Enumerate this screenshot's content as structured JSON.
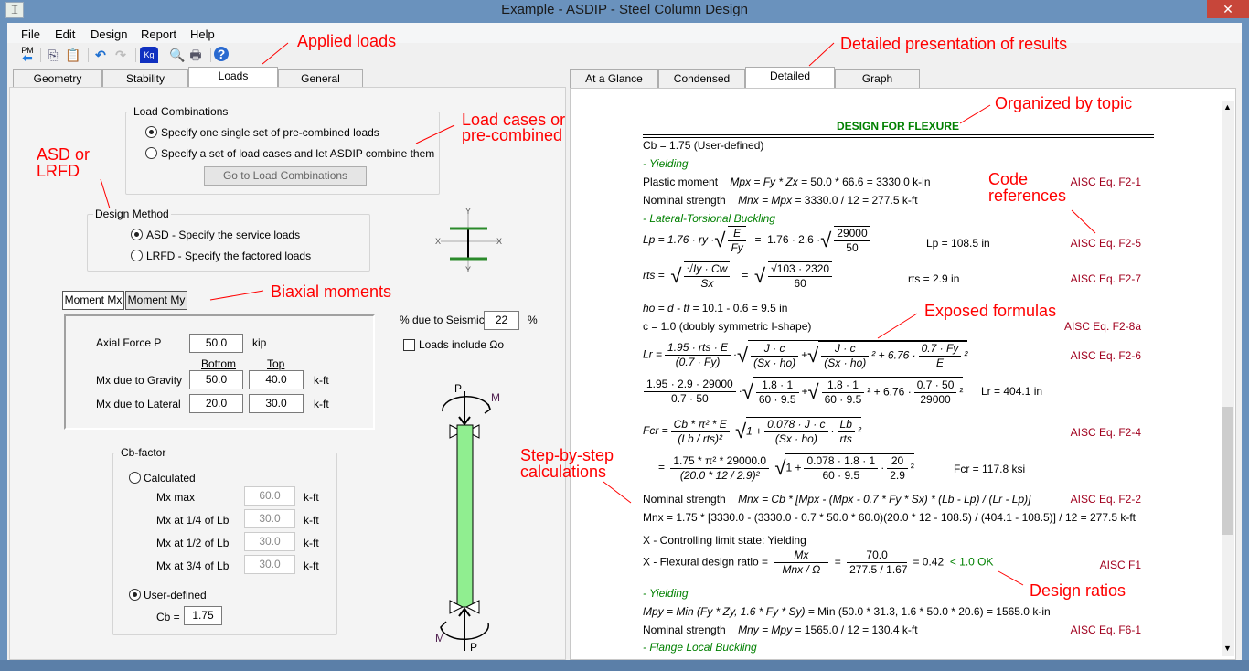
{
  "window": {
    "title": "Example - ASDIP - Steel Column Design",
    "close": "✕",
    "app_icon": "I-beam-icon"
  },
  "menu": [
    "File",
    "Edit",
    "Design",
    "Report",
    "Help"
  ],
  "toolbar": {
    "pm": "PM",
    "icons": [
      "pm-back-icon",
      "copy-icon",
      "paste-icon",
      "undo-icon",
      "redo-icon",
      "units-kg-icon",
      "preview-icon",
      "print-icon",
      "help-icon"
    ]
  },
  "left_tabs": [
    "Geometry",
    "Stability",
    "Loads",
    "General"
  ],
  "right_tabs": [
    "At a Glance",
    "Condensed",
    "Detailed",
    "Graph"
  ],
  "loads": {
    "load_combinations": {
      "title": "Load Combinations",
      "opt1": "Specify one single set of pre-combined loads",
      "opt2": "Specify a set of load cases and let ASDIP combine them",
      "button": "Go to Load Combinations"
    },
    "design_method": {
      "title": "Design Method",
      "asd": "ASD - Specify the service loads",
      "lrfd": "LRFD - Specify the factored loads"
    },
    "section": {
      "x": "X",
      "y": "Y"
    },
    "moment_tabs": [
      "Moment Mx",
      "Moment My"
    ],
    "axial_label": "Axial Force  P",
    "axial_value": "50.0",
    "axial_unit": "kip",
    "col_bottom": "Bottom",
    "col_top": "Top",
    "gravity_label": "Mx due to Gravity",
    "gravity_bottom": "50.0",
    "gravity_top": "40.0",
    "lateral_label": "Mx due to Lateral",
    "lateral_bottom": "20.0",
    "lateral_top": "30.0",
    "moment_unit": "k-ft",
    "seismic_label": "% due to Seismic",
    "seismic_value": "22",
    "seismic_unit": "%",
    "omega_label": "Loads include Ωo",
    "cb": {
      "title": "Cb-factor",
      "calculated": "Calculated",
      "mxmax_label": "Mx max",
      "mxmax": "60.0",
      "q1_label": "Mx at 1/4 of Lb",
      "q1": "30.0",
      "q2_label": "Mx at 1/2 of Lb",
      "q2": "30.0",
      "q3_label": "Mx at 3/4 of Lb",
      "q3": "30.0",
      "unit": "k-ft",
      "user": "User-defined",
      "cb_label": "Cb =",
      "cb_value": "1.75"
    },
    "diagram": {
      "p": "P",
      "m": "M"
    }
  },
  "report": {
    "heading": "DESIGN FOR FLEXURE",
    "cb": "Cb = 1.75    (User-defined)",
    "yielding": "- Yielding",
    "plastic_label": "Plastic moment",
    "plastic_f": "Mpx = Fy * Zx = ",
    "plastic_v": " 50.0 * 66.6 = 3330.0 k-in",
    "ref_f21": "AISC Eq. F2-1",
    "nominal_label": "Nominal strength",
    "nominal_f": "Mnx = Mpx = ",
    "nominal_v": " 3330.0 / 12  = 277.5 k-ft",
    "ltb": "- Lateral-Torsional Buckling",
    "lp": {
      "lhs": "Lp =  1.76 · ry ·",
      "num": "E",
      "den": "Fy",
      "eq": "=",
      "mid": "1.76 · 2.6 ·",
      "num2": "29000",
      "den2": "50",
      "result": "Lp = 108.5 in",
      "ref": "AISC Eq. F2-5"
    },
    "rts": {
      "lhs": "rts =",
      "num": "√Iy · Cw",
      "den": "Sx",
      "eq": "=",
      "num2": "√103 · 2320",
      "den2": "60",
      "result": "rts = 2.9 in",
      "ref": "AISC Eq. F2-7"
    },
    "ho": "ho = d - tf = ",
    "ho_v": " 10.1 - 0.6 = 9.5 in",
    "c": "c = 1.0     (doubly symmetric I-shape)",
    "ref_f28a": "AISC Eq. F2-8a",
    "lr": {
      "lhs": "Lr =",
      "n1": "1.95 · rts · E",
      "d1": "(0.7 · Fy)",
      "n2": "J · c",
      "d2": "(Sx · ho)",
      "n3": "J · c",
      "d3": "(Sx · ho)",
      "plus": "+ 6.76 ·",
      "n4": "0.7 · Fy",
      "d4": "E",
      "ref": "AISC Eq. F2-6"
    },
    "lr_num": {
      "n1": "1.95 · 2.9 · 29000",
      "d1": "0.7 · 50",
      "n2": "1.8 · 1",
      "d2": "60 · 9.5",
      "n3": "1.8 · 1",
      "d3": "60 · 9.5",
      "plus": "+ 6.76 ·",
      "n4": "0.7 · 50",
      "d4": "29000",
      "result": "Lr = 404.1 in"
    },
    "fcr": {
      "lhs": "Fcr =",
      "n1": "Cb * π² * E",
      "d1": "(Lb / rts)²",
      "one": "1 +",
      "n2": "0.078 · J · c",
      "d2": "(Sx · ho)",
      "n3": "Lb",
      "d3": "rts",
      "ref": "AISC Eq. F2-4"
    },
    "fcr_num": {
      "eq": "=",
      "n1": "1.75 * π² * 29000.0",
      "d1": "(20.0 * 12 / 2.9)²",
      "one": "1 +",
      "n2": "0.078 · 1.8 · 1",
      "d2": "60 · 9.5",
      "n3": "20",
      "d3": "2.9",
      "result": "Fcr = 117.8 ksi"
    },
    "mnx_label": "Nominal strength",
    "mnx_f": "Mnx = Cb * [Mpx - (Mpx - 0.7 * Fy * Sx) * (Lb - Lp) / (Lr - Lp)]",
    "ref_f22": "AISC Eq. F2-2",
    "mnx_v": "Mnx = 1.75 * [3330.0 - (3330.0 - 0.7 * 50.0 * 60.0)(20.0 * 12 - 108.5) / (404.1 - 108.5)] / 12 = 277.5 k-ft",
    "controlling": "X - Controlling limit state:  Yielding",
    "ratio": {
      "label": "X - Flexural design ratio = ",
      "n1": "Mx",
      "d1": "Mnx / Ω",
      "eq": "=",
      "n2": "70.0",
      "d2": "277.5 / 1.67",
      "value": "= 0.42",
      "ok": "< 1.0  OK",
      "ref": "AISC F1"
    },
    "yielding2": "- Yielding",
    "mpy_f": "Mpy = Min (Fy * Zy, 1.6 * Fy * Sy) = ",
    "mpy_v": " Min (50.0 * 31.3, 1.6 * 50.0 * 20.6) = 1565.0 k-in",
    "mny_label": "Nominal strength",
    "mny_f": "Mny = Mpy = ",
    "mny_v": " 1565.0 / 12  = 130.4 k-ft",
    "ref_f61": "AISC Eq. F6-1",
    "flb": "- Flange Local Buckling"
  },
  "annotations": {
    "applied": "Applied loads",
    "detailed": "Detailed presentation of results",
    "topic": "Organized by topic",
    "loadcases1": "Load cases or",
    "loadcases2": "pre-combined",
    "asd1": "ASD or",
    "asd2": "LRFD",
    "biaxial": "Biaxial moments",
    "code1": "Code",
    "code2": "references",
    "formulas": "Exposed formulas",
    "step1": "Step-by-step",
    "step2": "calculations",
    "ratios": "Design ratios"
  },
  "colors": {
    "accent_red": "#ff0000",
    "ref_red": "#a0001e",
    "green": "#008000",
    "column": "#90ee90"
  }
}
